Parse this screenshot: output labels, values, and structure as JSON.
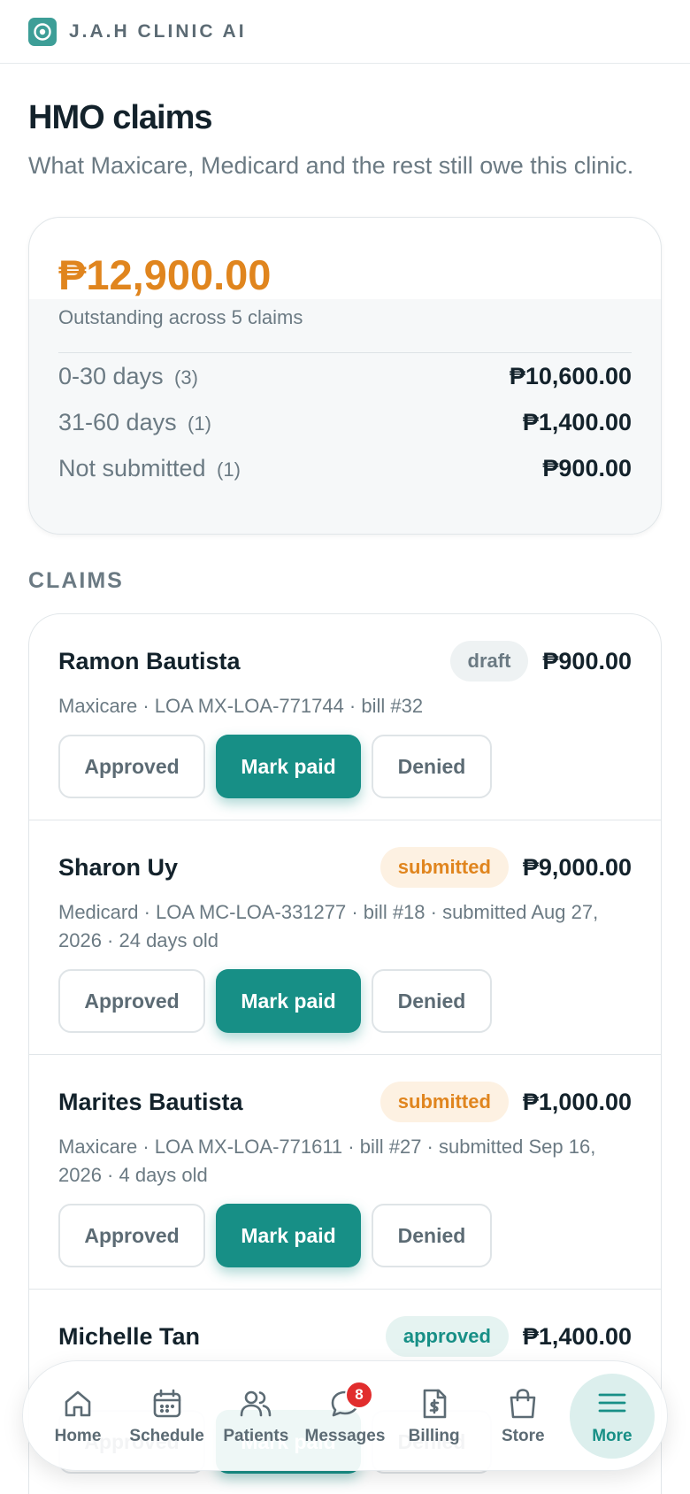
{
  "app": {
    "brand": "J.A.H CLINIC AI",
    "logo_icon": "clinic-logo-icon"
  },
  "page": {
    "title": "HMO claims",
    "subtitle": "What Maxicare, Medicard and the rest still owe this clinic."
  },
  "summary": {
    "total_outstanding": "₱12,900.00",
    "caption": "Outstanding across 5 claims",
    "aging": [
      {
        "label": "0-30 days",
        "count": "(3)",
        "amount": "₱10,600.00"
      },
      {
        "label": "31-60 days",
        "count": "(1)",
        "amount": "₱1,400.00"
      },
      {
        "label": "Not submitted",
        "count": "(1)",
        "amount": "₱900.00"
      }
    ]
  },
  "claims_section": {
    "label": "CLAIMS",
    "actions": {
      "approved": "Approved",
      "mark_paid": "Mark paid",
      "denied": "Denied"
    },
    "items": [
      {
        "patient": "Ramon Bautista",
        "status": "draft",
        "amount": "₱900.00",
        "meta": "Maxicare · LOA MX-LOA-771744 · bill #32"
      },
      {
        "patient": "Sharon Uy",
        "status": "submitted",
        "amount": "₱9,000.00",
        "meta": "Medicard · LOA MC-LOA-331277 · bill #18 · submitted Aug 27, 2026 · 24 days old"
      },
      {
        "patient": "Marites Bautista",
        "status": "submitted",
        "amount": "₱1,000.00",
        "meta": "Maxicare · LOA MX-LOA-771611 · bill #27 · submitted Sep 16, 2026 · 4 days old"
      },
      {
        "patient": "Michelle Tan",
        "status": "approved",
        "amount": "₱1,400.00",
        "meta": ""
      }
    ]
  },
  "bottom_nav": {
    "items": [
      {
        "label": "Home",
        "icon": "home-icon"
      },
      {
        "label": "Schedule",
        "icon": "calendar-icon"
      },
      {
        "label": "Patients",
        "icon": "users-icon"
      },
      {
        "label": "Messages",
        "icon": "chat-icon",
        "badge": "8"
      },
      {
        "label": "Billing",
        "icon": "invoice-icon"
      },
      {
        "label": "Store",
        "icon": "shopping-bag-icon"
      },
      {
        "label": "More",
        "icon": "menu-icon",
        "active": true
      }
    ]
  },
  "colors": {
    "accent": "#178f86",
    "outstanding": "#e0851e",
    "badge_alert": "#e12d2d"
  }
}
